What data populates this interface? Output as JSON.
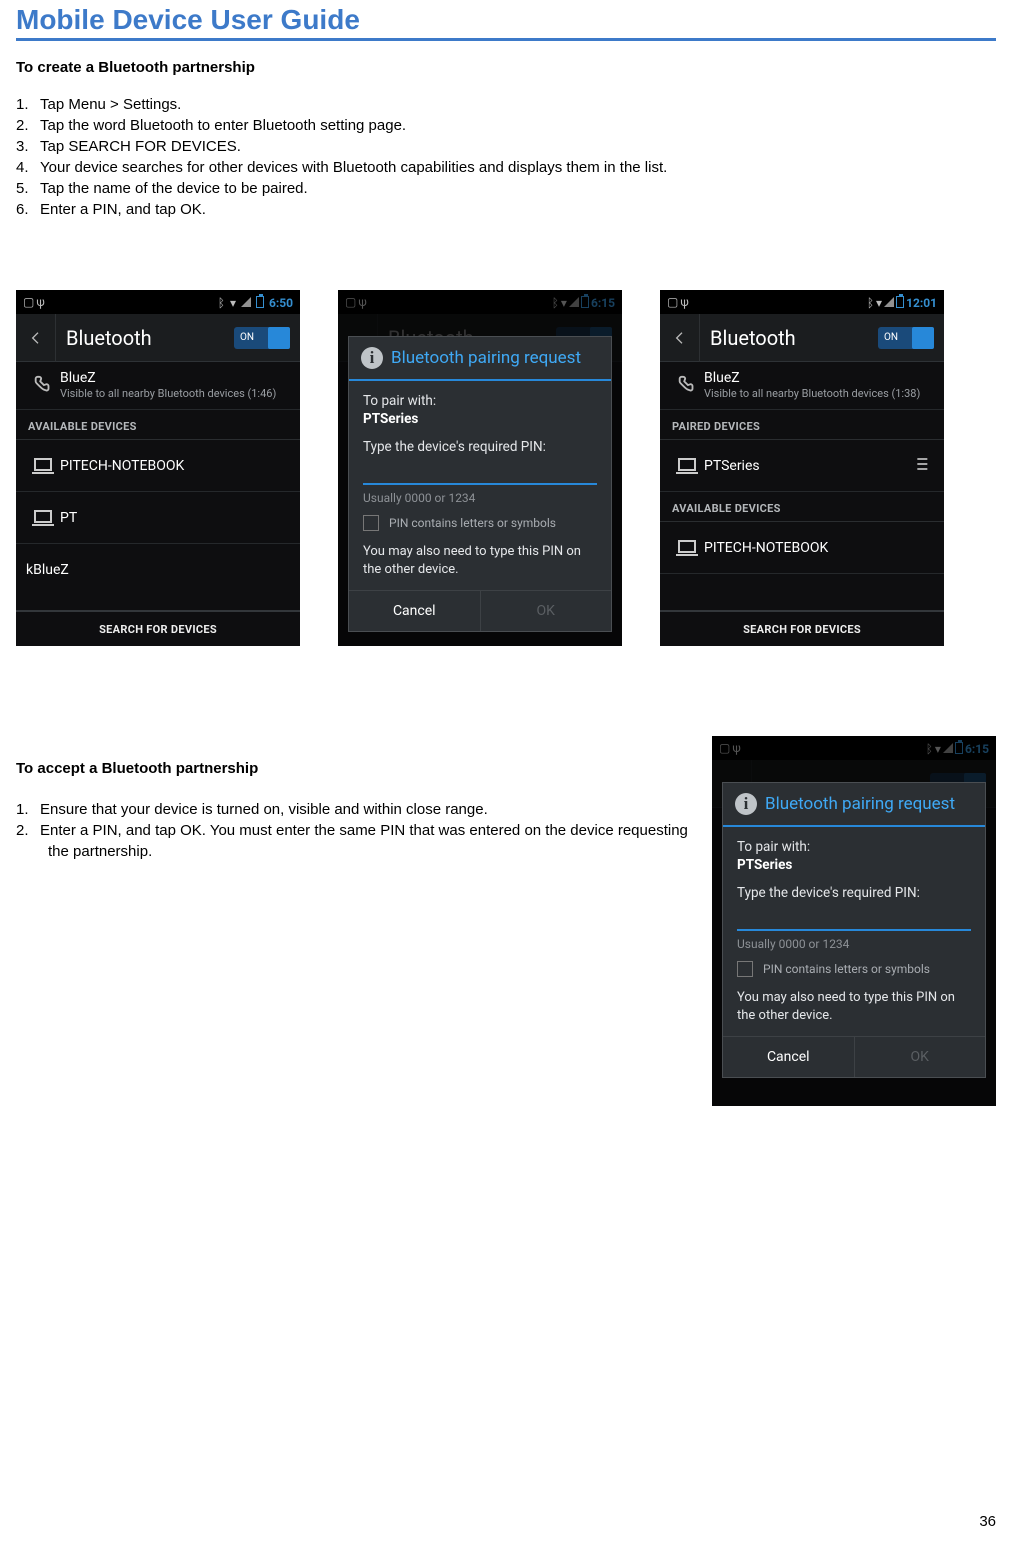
{
  "page": {
    "title": "Mobile Device User Guide",
    "number": "36"
  },
  "section1": {
    "heading": "To create a Bluetooth partnership",
    "steps": [
      "Tap Menu > Settings.",
      "Tap the word Bluetooth to enter Bluetooth setting page.",
      "Tap SEARCH FOR DEVICES.",
      "Your device searches for other devices with Bluetooth capabilities and displays them in the list.",
      "Tap the name of the device to be paired.",
      "Enter a PIN, and tap OK."
    ]
  },
  "section2": {
    "heading": "To accept a Bluetooth partnership",
    "steps": [
      "Ensure that your device is turned on, visible and within close range.",
      "Enter a PIN, and tap OK. You must enter the same PIN that was entered on the device requesting the partnership."
    ]
  },
  "common": {
    "actionbar_title": "Bluetooth",
    "toggle_label": "ON",
    "available_header": "AVAILABLE DEVICES",
    "paired_header": "PAIRED DEVICES",
    "search_label": "SEARCH FOR DEVICES"
  },
  "phone1": {
    "time": "6:50",
    "own_name": "BlueZ",
    "own_sub": "Visible to all nearby Bluetooth devices (1:46)",
    "dev1": "PITECH-NOTEBOOK",
    "dev2": "PT",
    "dev3": "kBlueZ"
  },
  "phone2": {
    "time": "6:15",
    "dlg_title": "Bluetooth pairing request",
    "pair_label": "To pair with:",
    "pair_name": "PTSeries",
    "type_label": "Type the device's required PIN:",
    "hint": "Usually 0000 or 1234",
    "chk": "PIN contains letters or symbols",
    "note": "You may also need to type this PIN on the other device.",
    "cancel": "Cancel",
    "ok": "OK"
  },
  "phone3": {
    "time": "12:01",
    "own_name": "BlueZ",
    "own_sub": "Visible to all nearby Bluetooth devices (1:38)",
    "paired_dev": "PTSeries",
    "avail_dev": "PITECH-NOTEBOOK"
  },
  "phone4": {
    "time": "6:15"
  }
}
